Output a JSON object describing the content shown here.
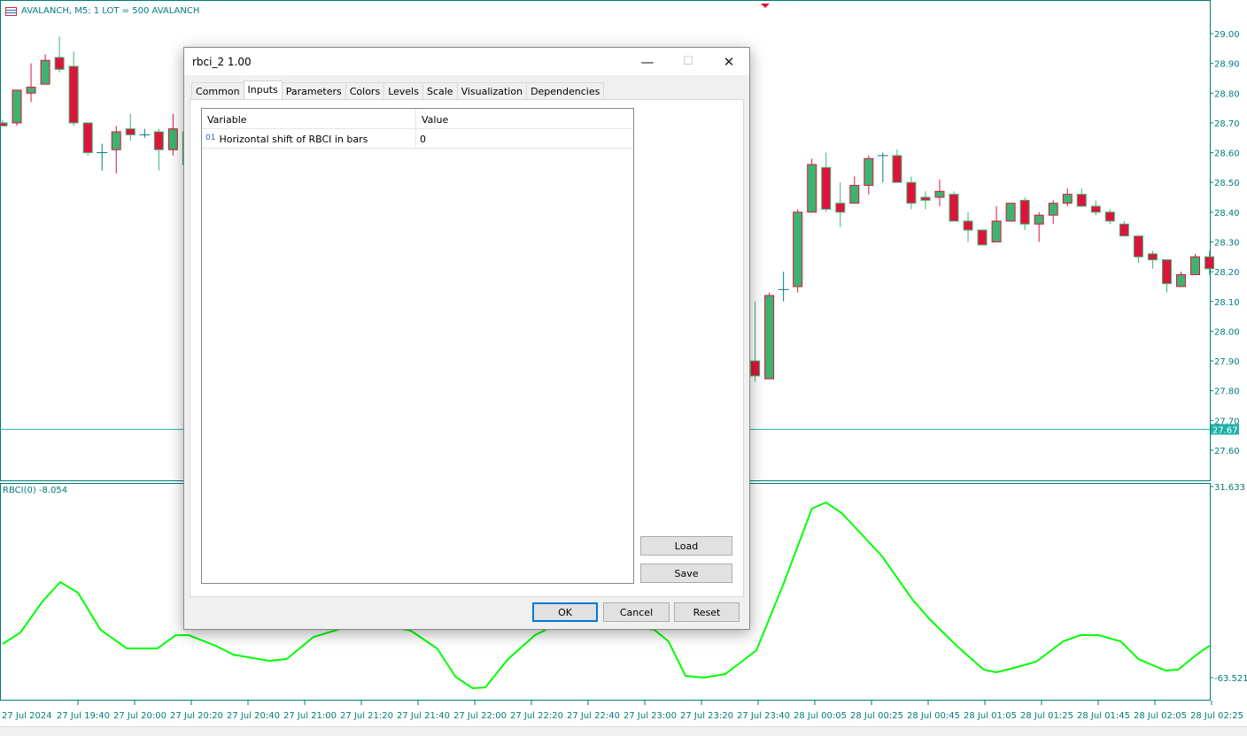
{
  "chart": {
    "symbol_label": "AVALANCH, M5:  1 LOT = 500 AVALANCH",
    "indicator_label": "RBCI(0) -8.054",
    "current_price": "27.67",
    "current_price_value": 27.67,
    "price_ticks": [
      "29.00",
      "28.90",
      "28.80",
      "28.70",
      "28.60",
      "28.50",
      "28.40",
      "28.30",
      "28.20",
      "28.10",
      "28.00",
      "27.90",
      "27.80",
      "27.70",
      "27.60"
    ],
    "indicator_ticks": [
      "31.633",
      "-63.521"
    ],
    "time_labels": [
      "27 Jul 2024",
      "27 Jul 19:40",
      "27 Jul 20:00",
      "27 Jul 20:20",
      "27 Jul 20:40",
      "27 Jul 21:00",
      "27 Jul 21:20",
      "27 Jul 21:40",
      "27 Jul 22:00",
      "27 Jul 22:20",
      "27 Jul 22:40",
      "27 Jul 23:00",
      "27 Jul 23:20",
      "27 Jul 23:40",
      "28 Jul 00:05",
      "28 Jul 00:25",
      "28 Jul 00:45",
      "28 Jul 01:05",
      "28 Jul 01:25",
      "28 Jul 01:45",
      "28 Jul 02:05",
      "28 Jul 02:25"
    ],
    "colors": {
      "bull": "#3cb371",
      "bear": "#dc143c",
      "axis": "#007b7b",
      "rbci": "#00ff00"
    },
    "candles": [
      [
        0,
        28.7,
        28.71,
        28.69,
        28.69
      ],
      [
        1,
        28.7,
        28.81,
        28.69,
        28.81
      ],
      [
        2,
        28.8,
        28.9,
        28.77,
        28.82
      ],
      [
        3,
        28.83,
        28.93,
        28.83,
        28.91
      ],
      [
        4,
        28.92,
        28.99,
        28.87,
        28.88
      ],
      [
        5,
        28.89,
        28.94,
        28.69,
        28.7
      ],
      [
        6,
        28.7,
        28.7,
        28.59,
        28.6
      ],
      [
        7,
        28.6,
        28.63,
        28.54,
        28.6
      ],
      [
        8,
        28.61,
        28.69,
        28.53,
        28.67
      ],
      [
        9,
        28.68,
        28.73,
        28.64,
        28.66
      ],
      [
        10,
        28.66,
        28.68,
        28.65,
        28.66
      ],
      [
        11,
        28.67,
        28.68,
        28.54,
        28.61
      ],
      [
        12,
        28.61,
        28.73,
        28.59,
        28.68
      ],
      [
        13,
        28.67,
        28.7,
        28.55,
        28.56
      ],
      [
        53,
        27.9,
        28.1,
        27.83,
        27.85
      ],
      [
        54,
        27.84,
        28.13,
        27.84,
        28.12
      ],
      [
        55,
        28.14,
        28.2,
        28.1,
        28.14
      ],
      [
        56,
        28.15,
        28.41,
        28.13,
        28.4
      ],
      [
        57,
        28.4,
        28.58,
        28.4,
        28.56
      ],
      [
        58,
        28.55,
        28.6,
        28.4,
        28.41
      ],
      [
        59,
        28.43,
        28.5,
        28.35,
        28.4
      ],
      [
        60,
        28.43,
        28.52,
        28.43,
        28.49
      ],
      [
        61,
        28.49,
        28.59,
        28.46,
        28.58
      ],
      [
        62,
        28.59,
        28.6,
        28.5,
        28.59
      ],
      [
        63,
        28.59,
        28.61,
        28.5,
        28.5
      ],
      [
        64,
        28.5,
        28.52,
        28.41,
        28.43
      ],
      [
        65,
        28.45,
        28.47,
        28.41,
        28.44
      ],
      [
        66,
        28.45,
        28.51,
        28.42,
        28.47
      ],
      [
        67,
        28.46,
        28.47,
        28.37,
        28.37
      ],
      [
        68,
        28.37,
        28.4,
        28.3,
        28.34
      ],
      [
        69,
        28.34,
        28.34,
        28.29,
        28.29
      ],
      [
        70,
        28.3,
        28.42,
        28.3,
        28.37
      ],
      [
        71,
        28.37,
        28.43,
        28.37,
        28.43
      ],
      [
        72,
        28.44,
        28.45,
        28.34,
        28.36
      ],
      [
        73,
        28.36,
        28.4,
        28.3,
        28.39
      ],
      [
        74,
        28.39,
        28.44,
        28.36,
        28.43
      ],
      [
        75,
        28.43,
        28.48,
        28.42,
        28.46
      ],
      [
        76,
        28.46,
        28.48,
        28.42,
        28.42
      ],
      [
        77,
        28.42,
        28.44,
        28.39,
        28.4
      ],
      [
        78,
        28.4,
        28.41,
        28.36,
        28.37
      ],
      [
        79,
        28.36,
        28.37,
        28.32,
        28.32
      ],
      [
        80,
        28.32,
        28.32,
        28.23,
        28.25
      ],
      [
        81,
        28.26,
        28.27,
        28.21,
        28.24
      ],
      [
        82,
        28.24,
        28.24,
        28.13,
        28.16
      ],
      [
        83,
        28.15,
        28.2,
        28.15,
        28.19
      ],
      [
        84,
        28.19,
        28.26,
        28.19,
        28.25
      ],
      [
        85,
        28.25,
        28.27,
        28.19,
        28.21
      ]
    ],
    "rbci": [
      [
        0,
        -46.78
      ],
      [
        1.25,
        -41.06
      ],
      [
        2.8,
        -25.64
      ],
      [
        4.06,
        -15.94
      ],
      [
        5.3,
        -21.23
      ],
      [
        6.9,
        -39.73
      ],
      [
        8.75,
        -48.98
      ],
      [
        10.9,
        -48.98
      ],
      [
        12.2,
        -42.38
      ],
      [
        13.1,
        -42.38
      ],
      [
        15,
        -47.66
      ],
      [
        16.25,
        -52.07
      ],
      [
        18.75,
        -55.15
      ],
      [
        20,
        -54.27
      ],
      [
        21.9,
        -43.26
      ],
      [
        25,
        -36.65
      ],
      [
        27.8,
        -38.85
      ],
      [
        28.75,
        -40.17
      ],
      [
        30.6,
        -48.98
      ],
      [
        31.9,
        -63.08
      ],
      [
        33.1,
        -68.8
      ],
      [
        34,
        -68.4
      ],
      [
        35.6,
        -54.27
      ],
      [
        37.5,
        -42.38
      ],
      [
        38.75,
        -37.97
      ],
      [
        42.5,
        -36.65
      ],
      [
        45.9,
        -39.73
      ],
      [
        46.9,
        -45.46
      ],
      [
        48.1,
        -62.64
      ],
      [
        49.4,
        -63.52
      ],
      [
        50.9,
        -61.76
      ],
      [
        53.1,
        -49.86
      ],
      [
        55,
        -16.82
      ],
      [
        57,
        20.62
      ],
      [
        58,
        23.7
      ],
      [
        59.1,
        18.42
      ],
      [
        61.9,
        -2.73
      ],
      [
        64.1,
        -24.76
      ],
      [
        65.3,
        -34.45
      ],
      [
        67.2,
        -47.66
      ],
      [
        69.1,
        -59.55
      ],
      [
        70,
        -60.88
      ],
      [
        71.25,
        -58.68
      ],
      [
        72.8,
        -55.59
      ],
      [
        74.7,
        -45.46
      ],
      [
        75.9,
        -42.38
      ],
      [
        77.2,
        -42.38
      ],
      [
        78.75,
        -45.46
      ],
      [
        80,
        -54.27
      ],
      [
        81.9,
        -59.99
      ],
      [
        82.8,
        -59.55
      ],
      [
        84.1,
        -52.07
      ],
      [
        85,
        -47.66
      ]
    ]
  },
  "dialog": {
    "title": "rbci_2 1.00",
    "tabs": [
      {
        "label": "Common"
      },
      {
        "label": "Inputs"
      },
      {
        "label": "Parameters"
      },
      {
        "label": "Colors"
      },
      {
        "label": "Levels"
      },
      {
        "label": "Scale"
      },
      {
        "label": "Visualization"
      },
      {
        "label": "Dependencies"
      }
    ],
    "active_tab": "Inputs",
    "grid": {
      "headers": [
        "Variable",
        "Value"
      ],
      "rows": [
        {
          "type": "01",
          "variable": "Horizontal shift of RBCI in bars",
          "value": "0"
        }
      ]
    },
    "load_label": "Load",
    "save_label": "Save",
    "ok_label": "OK",
    "cancel_label": "Cancel",
    "reset_label": "Reset",
    "minimize_glyph": "—",
    "maximize_glyph": "☐",
    "close_glyph": "✕"
  }
}
